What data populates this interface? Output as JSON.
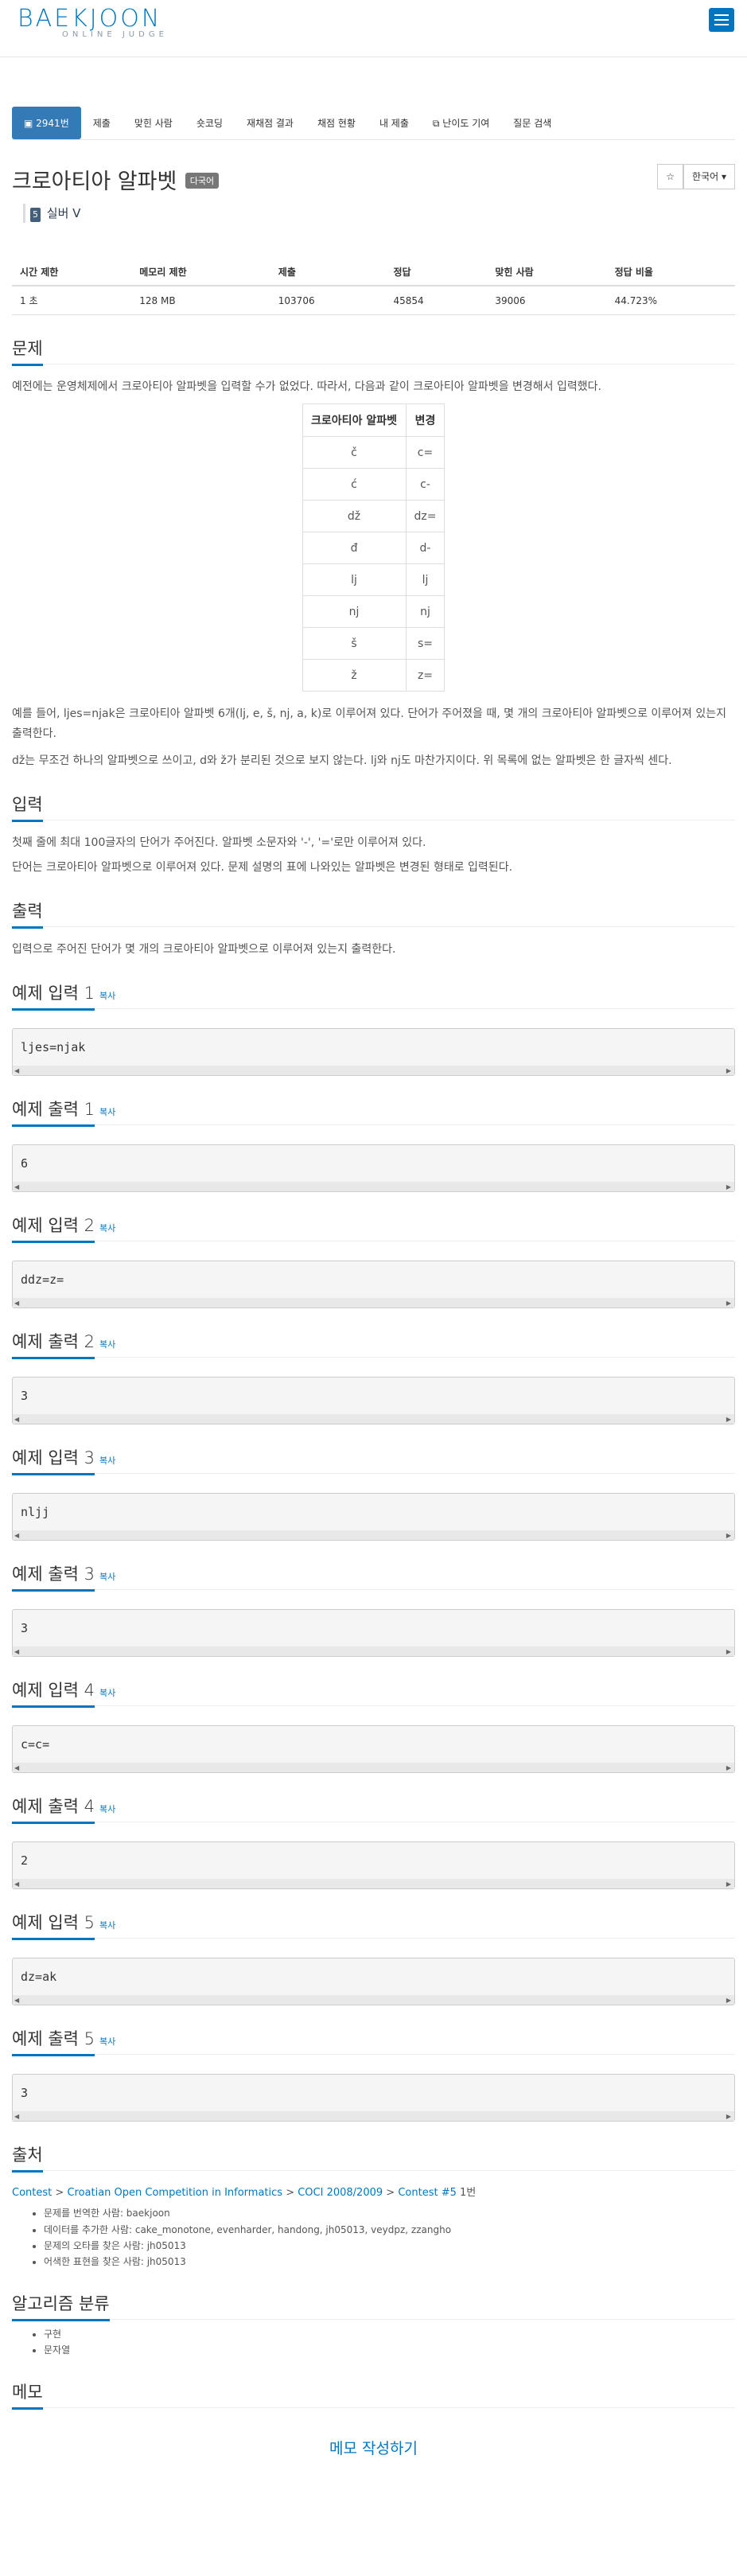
{
  "header": {
    "logo_main": "BAEKJOON",
    "logo_sub": "ONLINE JUDGE"
  },
  "tabs": [
    "2941번",
    "제출",
    "맞힌 사람",
    "숏코딩",
    "재채점 결과",
    "채점 현황",
    "내 제출",
    "난이도 기여",
    "질문 검색"
  ],
  "problem": {
    "title": "크로아티아 알파벳",
    "badge": "다국어",
    "star": "☆",
    "language": "한국어",
    "tier_num": "5",
    "tier": "실버 V"
  },
  "info_headers": [
    "시간 제한",
    "메모리 제한",
    "제출",
    "정답",
    "맞힌 사람",
    "정답 비율"
  ],
  "info_values": [
    "1 초",
    "128 MB",
    "103706",
    "45854",
    "39006",
    "44.723%"
  ],
  "sections": {
    "problem": "문제",
    "input": "입력",
    "output": "출력",
    "source": "출처",
    "algo": "알고리즘 분류",
    "memo": "메모"
  },
  "problem_text": {
    "intro": "예전에는 운영체제에서 크로아티아 알파벳을 입력할 수가 없었다. 따라서, 다음과 같이 크로아티아 알파벳을 변경해서 입력했다.",
    "example": "예를 들어, ljes=njak은 크로아티아 알파벳 6개(lj, e, š, nj, a, k)로 이루어져 있다. 단어가 주어졌을 때, 몇 개의 크로아티아 알파벳으로 이루어져 있는지 출력한다.",
    "dz_note": "dž는 무조건 하나의 알파벳으로 쓰이고, d와 ž가 분리된 것으로 보지 않는다. lj와 nj도 마찬가지이다. 위 목록에 없는 알파벳은 한 글자씩 센다."
  },
  "alpha_table": {
    "head": [
      "크로아티아 알파벳",
      "변경"
    ],
    "rows": [
      [
        "č",
        "c="
      ],
      [
        "ć",
        "c-"
      ],
      [
        "dž",
        "dz="
      ],
      [
        "đ",
        "d-"
      ],
      [
        "lj",
        "lj"
      ],
      [
        "nj",
        "nj"
      ],
      [
        "š",
        "s="
      ],
      [
        "ž",
        "z="
      ]
    ]
  },
  "input_text": [
    "첫째 줄에 최대 100글자의 단어가 주어진다. 알파벳 소문자와 '-', '='로만 이루어져 있다.",
    "단어는 크로아티아 알파벳으로 이루어져 있다. 문제 설명의 표에 나와있는 알파벳은 변경된 형태로 입력된다."
  ],
  "output_text": "입력으로 주어진 단어가 몇 개의 크로아티아 알파벳으로 이루어져 있는지 출력한다.",
  "copy_label": "복사",
  "samples": [
    {
      "title": "예제 입력 1",
      "body": "ljes=njak"
    },
    {
      "title": "예제 출력 1",
      "body": "6"
    },
    {
      "title": "예제 입력 2",
      "body": "ddz=z="
    },
    {
      "title": "예제 출력 2",
      "body": "3"
    },
    {
      "title": "예제 입력 3",
      "body": "nljj"
    },
    {
      "title": "예제 출력 3",
      "body": "3"
    },
    {
      "title": "예제 입력 4",
      "body": "c=c="
    },
    {
      "title": "예제 출력 4",
      "body": "2"
    },
    {
      "title": "예제 입력 5",
      "body": "dz=ak"
    },
    {
      "title": "예제 출력 5",
      "body": "3"
    }
  ],
  "source": {
    "links": [
      "Contest",
      "Croatian Open Competition in Informatics",
      "COCI 2008/2009",
      "Contest #5"
    ],
    "sep": ">",
    "tail": "1번",
    "credits": [
      "문제를 번역한 사람: baekjoon",
      "데이터를 추가한 사람: cake_monotone, evenharder, handong, jh05013, veydpz, zzangho",
      "문제의 오타를 찾은 사람: jh05013",
      "어색한 표현을 찾은 사람: jh05013"
    ]
  },
  "algorithms": [
    "구현",
    "문자열"
  ],
  "memo_link": "메모 작성하기"
}
